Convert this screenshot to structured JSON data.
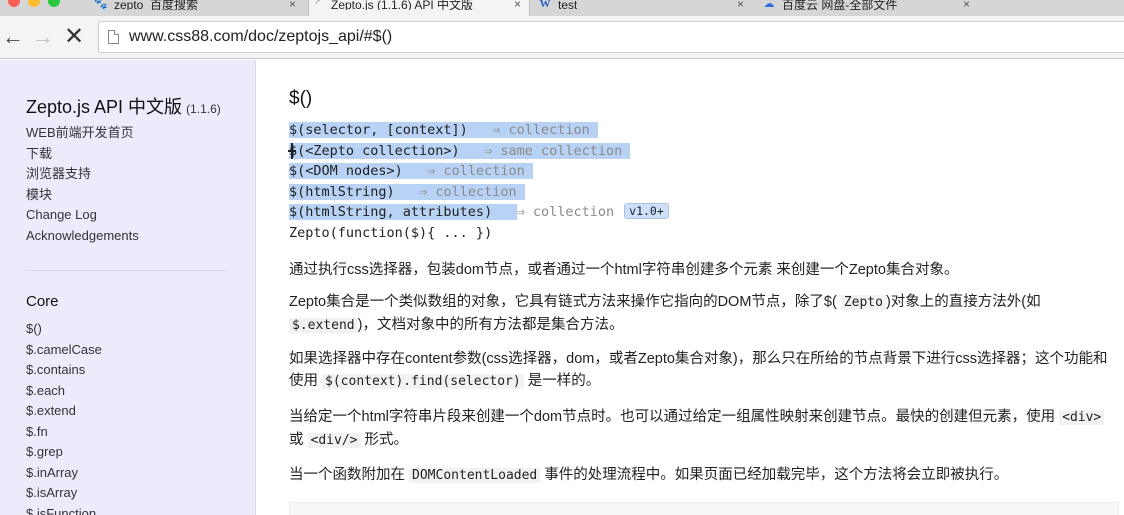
{
  "browser": {
    "tabs": [
      {
        "icon": "baidu-paw-icon",
        "title": "zepto_百度搜索",
        "close": "×",
        "active": false
      },
      {
        "icon": "loading-tab-icon",
        "title": "Zepto.js (1.1.6) API 中文版",
        "close": "×",
        "active": true
      },
      {
        "icon": "w-icon",
        "title": "test",
        "close": "×",
        "active": false
      },
      {
        "icon": "baidu-cloud-icon",
        "title": "百度云 网盘-全部文件",
        "close": "×",
        "active": false
      }
    ],
    "nav": {
      "back": "←",
      "forward": "→",
      "stop": "✕"
    },
    "url": "www.css88.com/doc/zeptojs_api/#$()"
  },
  "sidebar": {
    "title": "Zepto.js API 中文版",
    "version": "(1.1.6)",
    "links": [
      "WEB前端开发首页",
      "下载",
      "浏览器支持",
      "模块",
      "Change Log",
      "Acknowledgements"
    ],
    "section_title": "Core",
    "core_items": [
      "$()",
      "$.camelCase",
      "$.contains",
      "$.each",
      "$.extend",
      "$.fn",
      "$.grep",
      "$.inArray",
      "$.isArray",
      "$.isFunction"
    ]
  },
  "main": {
    "heading": "$()",
    "signatures": [
      {
        "code": "$(selector, [context])",
        "returns": "⇒ collection"
      },
      {
        "code": "$(<Zepto collection>)",
        "returns": "⇒ same collection"
      },
      {
        "code": "$(<DOM nodes>)",
        "returns": "⇒ collection"
      },
      {
        "code": "$(htmlString)",
        "returns": "⇒ collection"
      },
      {
        "code": "$(htmlString, attributes)",
        "returns": "⇒ collection",
        "badge": "v1.0+"
      },
      {
        "code": "Zepto(function($){ ... })",
        "returns": ""
      }
    ],
    "p1": "通过执行css选择器，包装dom节点，或者通过一个html字符串创建多个元素 来创建一个Zepto集合对象。",
    "p2": {
      "a": "Zepto集合是一个类似数组的对象，它具有链式方法来操作它指向的DOM节点，除了$( ",
      "code1": "Zepto",
      "b": ")对象上的直接方法外(如 ",
      "code2": "$.extend",
      "c": ")，文档对象中的所有方法都是集合方法。"
    },
    "p3": {
      "a": "如果选择器中存在content参数(css选择器，dom，或者Zepto集合对象)，那么只在所给的节点背景下进行css选择器；这个功能和使用 ",
      "code": "$(context).find(selector)",
      "b": " 是一样的。"
    },
    "p4": {
      "a": "当给定一个html字符串片段来创建一个dom节点时。也可以通过给定一组属性映射来创建节点。最快的创建但元素，使用 ",
      "code1": "<div>",
      "b": " 或 ",
      "code2": "<div/>",
      "c": " 形式。"
    },
    "p5": {
      "a": "当一个函数附加在 ",
      "code": "DOMContentLoaded",
      "b": " 事件的处理流程中。如果页面已经加载完毕，这个方法将会立即被执行。"
    }
  },
  "colors": {
    "sidebar_bg": "#eeeafb",
    "selection": "#b7d2f4",
    "badge_bg": "#cfe0f6"
  }
}
